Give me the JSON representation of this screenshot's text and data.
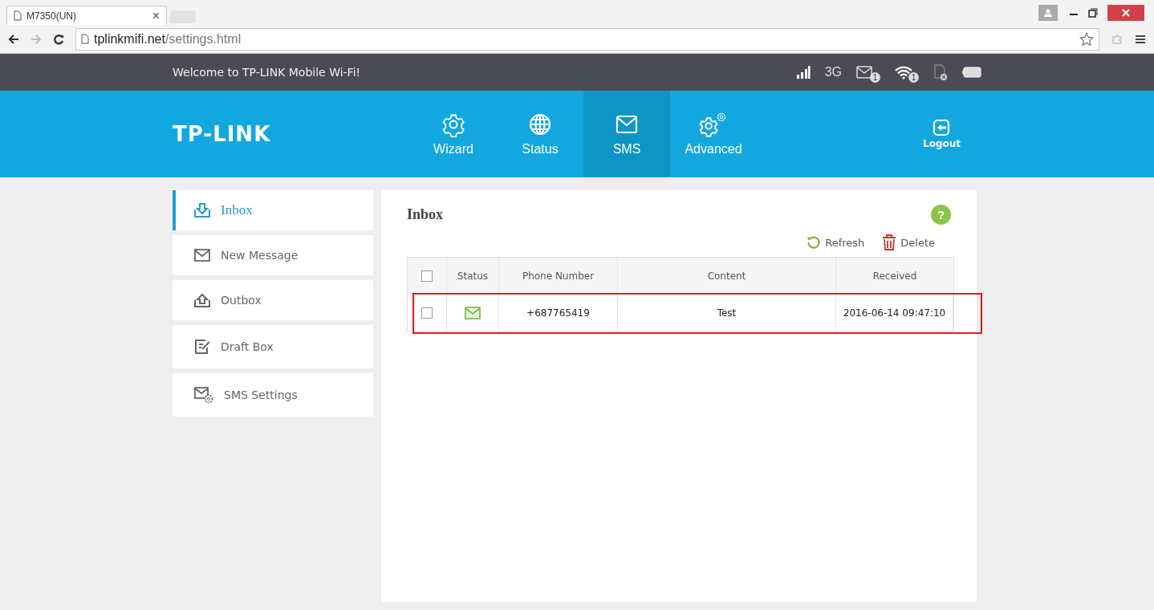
{
  "browser": {
    "tab_title": "M7350(UN)",
    "tab_close": "×",
    "url_host": "tplinkmifi.net",
    "url_path": "/settings.html"
  },
  "top_bar": {
    "welcome": "Welcome to TP-LINK Mobile Wi-Fi!",
    "network": "3G",
    "sms_badge": "1",
    "wifi_badge": "1"
  },
  "header": {
    "logo": "TP-LINK",
    "logout": "Logout",
    "nav": [
      {
        "kind": "wizard",
        "label": "Wizard",
        "selected": false
      },
      {
        "kind": "status",
        "label": "Status",
        "selected": false
      },
      {
        "kind": "sms",
        "label": "SMS",
        "selected": true
      },
      {
        "kind": "advanced",
        "label": "Advanced",
        "selected": false
      }
    ]
  },
  "sidebar": {
    "items": [
      {
        "kind": "inbox",
        "label": "Inbox",
        "selected": true
      },
      {
        "kind": "new",
        "label": "New Message",
        "selected": false
      },
      {
        "kind": "outbox",
        "label": "Outbox",
        "selected": false
      },
      {
        "kind": "draft",
        "label": "Draft Box",
        "selected": false
      },
      {
        "kind": "settings",
        "label": "SMS Settings",
        "selected": false
      }
    ]
  },
  "panel": {
    "title": "Inbox",
    "help": "?",
    "actions": [
      {
        "kind": "refresh",
        "label": "Refresh"
      },
      {
        "kind": "delete",
        "label": "Delete"
      }
    ],
    "table": {
      "select_all": {
        "checked": false
      },
      "columns": [
        "Status",
        "Phone Number",
        "Content",
        "Received"
      ],
      "rows": [
        {
          "checked": false,
          "unread": true,
          "highlighted": true,
          "phone": "+687765419",
          "content": "Test",
          "received": "2016-06-14 09:47:10"
        }
      ]
    }
  }
}
